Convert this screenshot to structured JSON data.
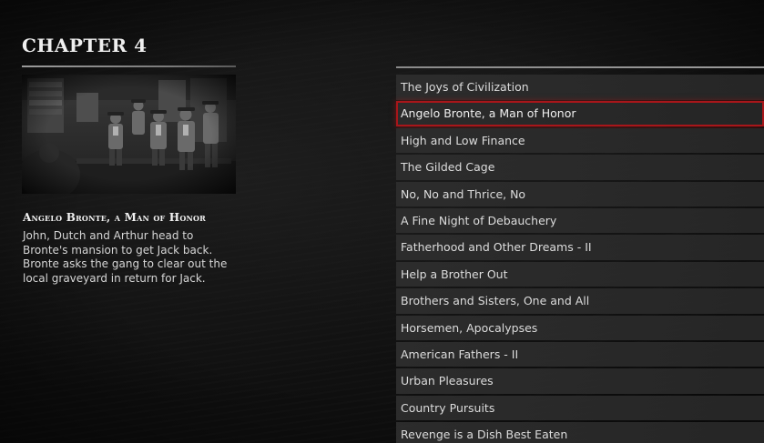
{
  "chapter": {
    "title": "CHAPTER 4"
  },
  "selected_mission": {
    "name": "Angelo Bronte, a Man of Honor",
    "description_lines": [
      "John, Dutch and Arthur head to",
      "Bronte's mansion to get Jack back.",
      "Bronte asks the gang to clear out the",
      "local graveyard in return for Jack."
    ]
  },
  "missions": [
    {
      "label": "The Joys of Civilization",
      "selected": false
    },
    {
      "label": "Angelo Bronte, a Man of Honor",
      "selected": true
    },
    {
      "label": "High and Low Finance",
      "selected": false
    },
    {
      "label": "The Gilded Cage",
      "selected": false
    },
    {
      "label": "No, No and Thrice, No",
      "selected": false
    },
    {
      "label": "A Fine Night of Debauchery",
      "selected": false
    },
    {
      "label": "Fatherhood and Other Dreams - II",
      "selected": false
    },
    {
      "label": "Help a Brother Out",
      "selected": false
    },
    {
      "label": "Brothers and Sisters, One and All",
      "selected": false
    },
    {
      "label": "Horsemen, Apocalypses",
      "selected": false
    },
    {
      "label": "American Fathers - II",
      "selected": false
    },
    {
      "label": "Urban Pleasures",
      "selected": false
    },
    {
      "label": "Country Pursuits",
      "selected": false
    },
    {
      "label": "Revenge is a Dish Best Eaten",
      "selected": false
    }
  ],
  "colors": {
    "selection_outline": "#a8161a",
    "background": "#0f0f0f",
    "row_background": "#2e2e2e"
  },
  "icons": {
    "mission_photo": "sepia-photo-gang-in-parlor"
  }
}
